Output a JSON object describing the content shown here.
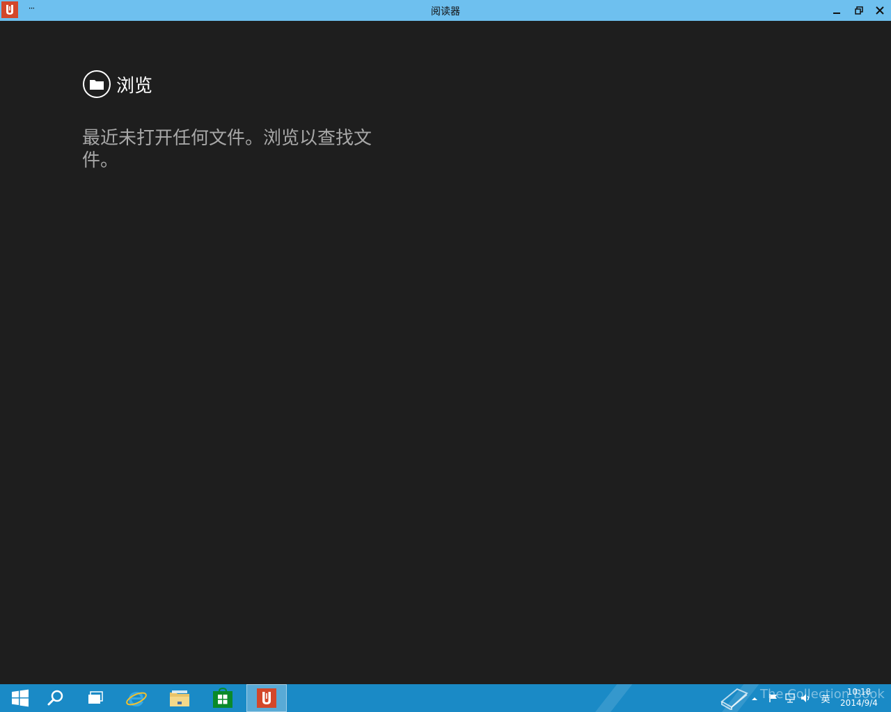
{
  "window": {
    "title": "阅读器",
    "more_label": "···",
    "app_icon_glyph": "U"
  },
  "main": {
    "browse_label": "浏览",
    "message": "最近未打开任何文件。浏览以查找文件。"
  },
  "taskbar": {
    "apps": [
      {
        "name": "start",
        "icon": "windows-logo-icon"
      },
      {
        "name": "search",
        "icon": "search-icon"
      },
      {
        "name": "task-view",
        "icon": "task-view-icon"
      },
      {
        "name": "internet-explorer",
        "icon": "ie-icon"
      },
      {
        "name": "file-explorer",
        "icon": "folder-icon"
      },
      {
        "name": "store",
        "icon": "store-icon"
      },
      {
        "name": "reader",
        "icon": "reader-icon",
        "active": true
      }
    ],
    "tray": {
      "ime_label": "英",
      "time": "10:18",
      "date": "2014/9/4"
    },
    "watermark": "The Collection Book"
  },
  "colors": {
    "titlebar": "#6ec0ef",
    "background": "#1e1e1e",
    "taskbar": "#1a8ac6",
    "reader_red": "#d3472a"
  }
}
